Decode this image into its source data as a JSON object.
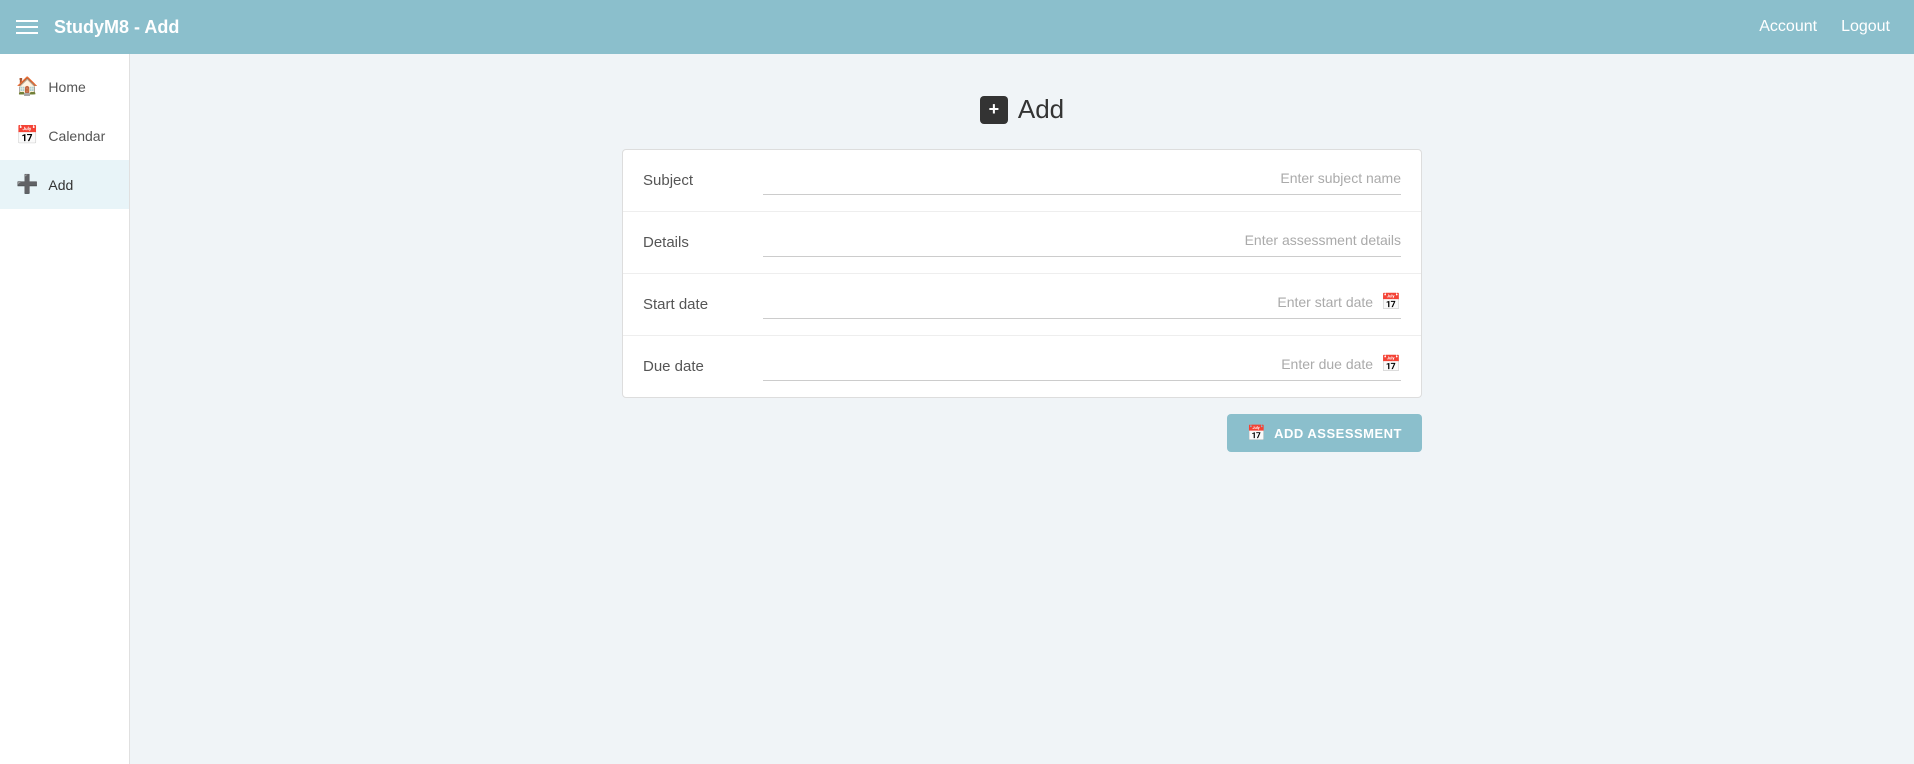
{
  "topbar": {
    "menu_icon": "☰",
    "title": "StudyM8 - Add",
    "account_label": "Account",
    "logout_label": "Logout"
  },
  "sidebar": {
    "items": [
      {
        "id": "home",
        "label": "Home",
        "icon": "🏠",
        "active": false
      },
      {
        "id": "calendar",
        "label": "Calendar",
        "icon": "📅",
        "active": false
      },
      {
        "id": "add",
        "label": "Add",
        "icon": "➕",
        "active": true
      }
    ]
  },
  "main": {
    "page_title": "Add",
    "page_title_icon": "+",
    "form": {
      "subject_label": "Subject",
      "subject_placeholder": "Enter subject name",
      "details_label": "Details",
      "details_placeholder": "Enter assessment details",
      "start_date_label": "Start date",
      "start_date_placeholder": "Enter start date",
      "due_date_label": "Due date",
      "due_date_placeholder": "Enter due date"
    },
    "add_button_label": "ADD ASSESSMENT",
    "add_button_icon": "📅"
  }
}
